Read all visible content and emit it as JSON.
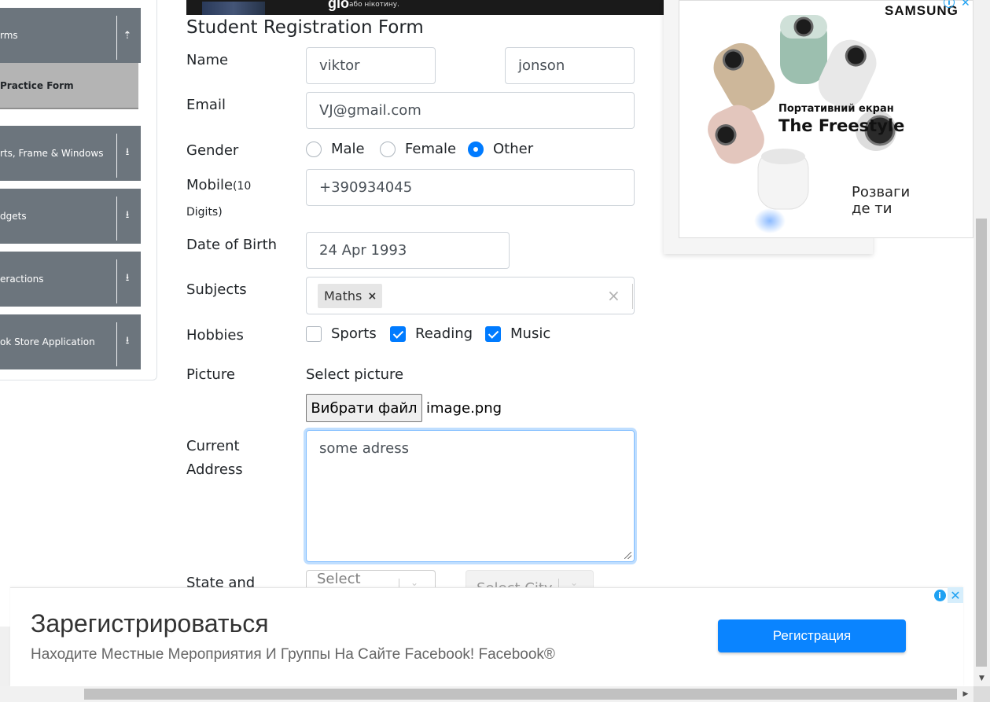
{
  "sidebar": {
    "groups": [
      {
        "label": "rms",
        "icon": "chevron-up-icon",
        "glyph": "⇡"
      },
      {
        "label": "rts, Frame & Windows",
        "icon": "download-arrow-icon",
        "glyph": "⭳"
      },
      {
        "label": "dgets",
        "icon": "download-arrow-icon",
        "glyph": "⭳"
      },
      {
        "label": "eractions",
        "icon": "download-arrow-icon",
        "glyph": "⭳"
      },
      {
        "label": "ok Store Application",
        "icon": "download-arrow-icon",
        "glyph": "⭳"
      }
    ],
    "active_item": "Practice Form"
  },
  "top_ad": {
    "logo": "glo",
    "text": "або нікотину."
  },
  "form": {
    "title": "Student Registration Form",
    "name_label": "Name",
    "first_name": "viktor",
    "last_name": "jonson",
    "email_label": "Email",
    "email": "VJ@gmail.com",
    "gender_label": "Gender",
    "genders": [
      {
        "label": "Male",
        "selected": false
      },
      {
        "label": "Female",
        "selected": false
      },
      {
        "label": "Other",
        "selected": true
      }
    ],
    "mobile_label": "Mobile",
    "mobile_hint_1": "(10",
    "mobile_hint_2": "Digits)",
    "mobile": "+390934045",
    "dob_label": "Date of Birth",
    "dob": "24 Apr 1993",
    "subjects_label": "Subjects",
    "subjects": [
      "Maths"
    ],
    "subject_remove": "×",
    "subjects_clear": "×",
    "hobbies_label": "Hobbies",
    "hobbies": [
      {
        "label": "Sports",
        "checked": false
      },
      {
        "label": "Reading",
        "checked": true
      },
      {
        "label": "Music",
        "checked": true
      }
    ],
    "picture_label": "Picture",
    "picture_prompt": "Select picture",
    "file_button": "Вибрати файл",
    "file_name": "image.png",
    "address_label_1": "Current",
    "address_label_2": "Address",
    "address": "some adress",
    "state_city_label": "State and",
    "state_placeholder": "Select",
    "city_placeholder": "Select City"
  },
  "right_ad": {
    "brand": "SAMSUNG",
    "line1": "Портативний екран",
    "line2": "The Freestyle",
    "line3a": "Розваги",
    "line3b": "де ти",
    "info": "i",
    "close": "✕"
  },
  "bottom_ad": {
    "title": "Зарегистрироваться",
    "subtitle": "Находите Местные Мероприятия И Группы На Сайте Facebook! Facebook®",
    "button": "Регистрация",
    "info": "i",
    "close": "✕"
  },
  "colors": {
    "accent": "#007bff",
    "sidebar_group": "#6c757d",
    "sidebar_active": "#b4b4b4",
    "ad_button": "#0a84ff"
  }
}
